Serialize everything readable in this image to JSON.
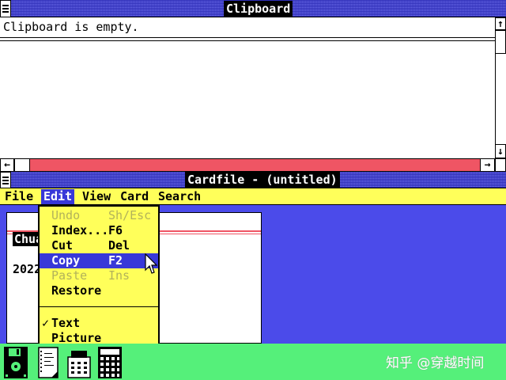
{
  "clipboard": {
    "title": "Clipboard",
    "content": "Clipboard is empty."
  },
  "cardfile": {
    "title": "Cardfile - (untitled)",
    "menus": [
      "File",
      "Edit",
      "View",
      "Card",
      "Search"
    ],
    "active_menu": "Edit",
    "card_index_line": "Chua",
    "card_body": "2022"
  },
  "edit_menu": {
    "items": [
      {
        "label": "Undo",
        "accel": "Sh/Esc",
        "enabled": false,
        "checked": false
      },
      {
        "label": "Index...",
        "accel": "F6",
        "enabled": true,
        "checked": false
      },
      {
        "label": "Cut",
        "accel": "Del",
        "enabled": true,
        "checked": false
      },
      {
        "label": "Copy",
        "accel": "F2",
        "enabled": true,
        "checked": false,
        "highlighted": true
      },
      {
        "label": "Paste",
        "accel": "Ins",
        "enabled": false,
        "checked": false
      },
      {
        "label": "Restore",
        "accel": "",
        "enabled": true,
        "checked": false
      },
      {
        "label": "Text",
        "accel": "",
        "enabled": true,
        "checked": true
      },
      {
        "label": "Picture",
        "accel": "",
        "enabled": true,
        "checked": false
      }
    ],
    "check_mark": "✓"
  },
  "scroll_glyphs": {
    "up": "↑",
    "down": "↓",
    "left": "←",
    "right": "→"
  },
  "taskbar": {
    "icons": [
      "floppy-disk-icon",
      "notepad-icon",
      "telephone-icon",
      "calculator-icon"
    ]
  },
  "watermark": "知乎 @穿越时间",
  "colors": {
    "title_bar": "#4a4ad0",
    "menu_bar": "#ffff5a",
    "workspace": "#4b4bea",
    "scrollbar": "#ef5564",
    "taskbar": "#55f07a",
    "highlight": "#3838d8"
  }
}
